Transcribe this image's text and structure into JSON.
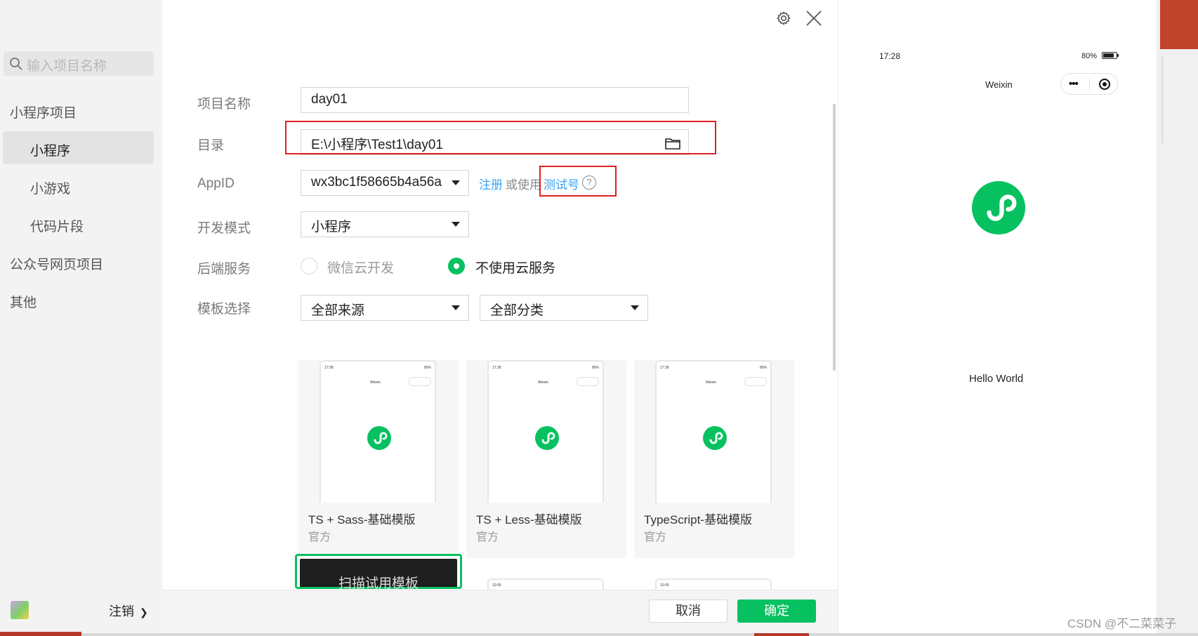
{
  "sidebar": {
    "search_placeholder": "输入项目名称",
    "groups": [
      {
        "label": "小程序项目",
        "items": [
          "小程序",
          "小游戏",
          "代码片段"
        ]
      },
      {
        "label": "公众号网页项目",
        "items": []
      },
      {
        "label": "其他",
        "items": []
      }
    ],
    "active_item": "小程序",
    "logout_label": "注销"
  },
  "form": {
    "name_label": "项目名称",
    "name_value": "day01",
    "dir_label": "目录",
    "dir_value": "E:\\小程序\\Test1\\day01",
    "appid_label": "AppID",
    "appid_value": "wx3bc1f58665b4a56a",
    "register_link": "注册",
    "or_use": "或使用",
    "test_link": "测试号",
    "help_glyph": "?",
    "mode_label": "开发模式",
    "mode_value": "小程序",
    "backend_label": "后端服务",
    "backend_options": [
      "微信云开发",
      "不使用云服务"
    ],
    "backend_selected": "不使用云服务",
    "template_label": "模板选择",
    "source_value": "全部来源",
    "category_value": "全部分类"
  },
  "templates": [
    {
      "name": "TS + Sass-基础模版",
      "source": "官方"
    },
    {
      "name": "TS + Less-基础模版",
      "source": "官方"
    },
    {
      "name": "TypeScript-基础模版",
      "source": "官方"
    }
  ],
  "template_thumb": {
    "time": "17:28",
    "battery": "80%",
    "title": "Weixin"
  },
  "partial_thumb_time": "10:00",
  "scan_template_label": "扫描试用模板",
  "footer": {
    "cancel_label": "取消",
    "ok_label": "确定"
  },
  "preview": {
    "time": "17:28",
    "battery": "80%",
    "title": "Weixin",
    "dots": "•••",
    "content": "Hello World"
  },
  "watermark": "CSDN @不二菜菜子",
  "colors": {
    "accent_green": "#07c160",
    "link_blue": "#36a3f7",
    "highlight_red": "#e02020"
  },
  "icons": [
    "search-icon",
    "gear-icon",
    "close-icon",
    "folder-icon",
    "dropdown-caret-icon",
    "help-icon",
    "miniprogram-logo-icon",
    "more-dots-icon",
    "target-icon",
    "chevron-right-icon"
  ]
}
